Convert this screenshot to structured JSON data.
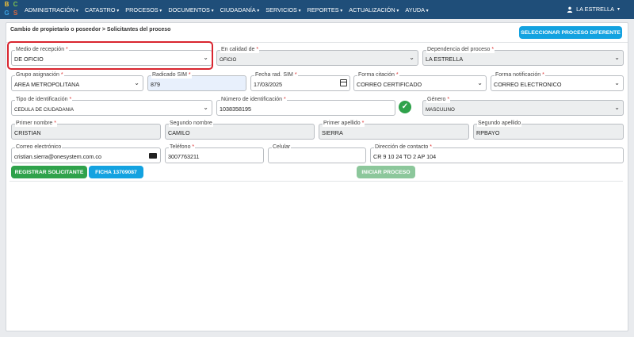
{
  "header": {
    "logo_letters": [
      "B",
      "C",
      "G",
      "S"
    ],
    "nav": [
      "ADMINISTRACIÓN",
      "CATASTRO",
      "PROCESOS",
      "DOCUMENTOS",
      "CIUDADANÍA",
      "SERVICIOS",
      "REPORTES",
      "ACTUALIZACIÓN",
      "AYUDA"
    ],
    "user": "LA ESTRELLA"
  },
  "page": {
    "breadcrumb": "Cambio de propietario o poseedor > Solicitantes del proceso",
    "select_button": "SELECCIONAR PROCESO DIFERENTE"
  },
  "form": {
    "medio_recepcion": {
      "label": "Medio de recepción",
      "value": "DE OFICIO"
    },
    "calidad": {
      "label": "En calidad de",
      "value": "OFICIO"
    },
    "dependencia": {
      "label": "Dependencia del proceso",
      "value": "LA ESTRELLA"
    },
    "grupo": {
      "label": "Grupo asignación",
      "value": "AREA METROPOLITANA"
    },
    "radicado": {
      "label": "Radicado SIM",
      "value": "879"
    },
    "fecha": {
      "label": "Fecha rad. SIM",
      "value": "17/03/2025"
    },
    "citacion": {
      "label": "Forma citación",
      "value": "CORREO CERTIFICADO"
    },
    "notificacion": {
      "label": "Forma notificación",
      "value": "CORREO ELECTRONICO"
    },
    "tipo_id": {
      "label": "Tipo de identificación",
      "value": "CEDULA DE CIUDADANIA"
    },
    "numero_id": {
      "label": "Número de identificación",
      "value": "1038358195"
    },
    "genero": {
      "label": "Género",
      "value": "MASCULINO"
    },
    "primer_nombre": {
      "label": "Primer nombre",
      "value": "CRISTIAN"
    },
    "segundo_nombre": {
      "label": "Segundo nombre",
      "value": "CAMILO"
    },
    "primer_apellido": {
      "label": "Primer apellido",
      "value": "SIERRA"
    },
    "segundo_apellido": {
      "label": "Segundo apellido",
      "value": "RPBAYO"
    },
    "correo": {
      "label": "Correo electrónico",
      "value": "cristian.sierra@onesystem.com.co"
    },
    "telefono": {
      "label": "Teléfono",
      "value": "3007763211"
    },
    "celular": {
      "label": "Celular",
      "value": ""
    },
    "direccion": {
      "label": "Dirección de contacto",
      "value": "CR 9 10 24 TO 2 AP 104"
    },
    "required_mark": "*"
  },
  "actions": {
    "registrar": "REGISTRAR SOLICITANTE",
    "ficha": "FICHA 13709087",
    "iniciar": "INICIAR PROCESO"
  },
  "colors": {
    "topbar": "#1f4e79",
    "accent": "#13a2e0",
    "success": "#2fa24b",
    "highlight": "#d9252f"
  }
}
